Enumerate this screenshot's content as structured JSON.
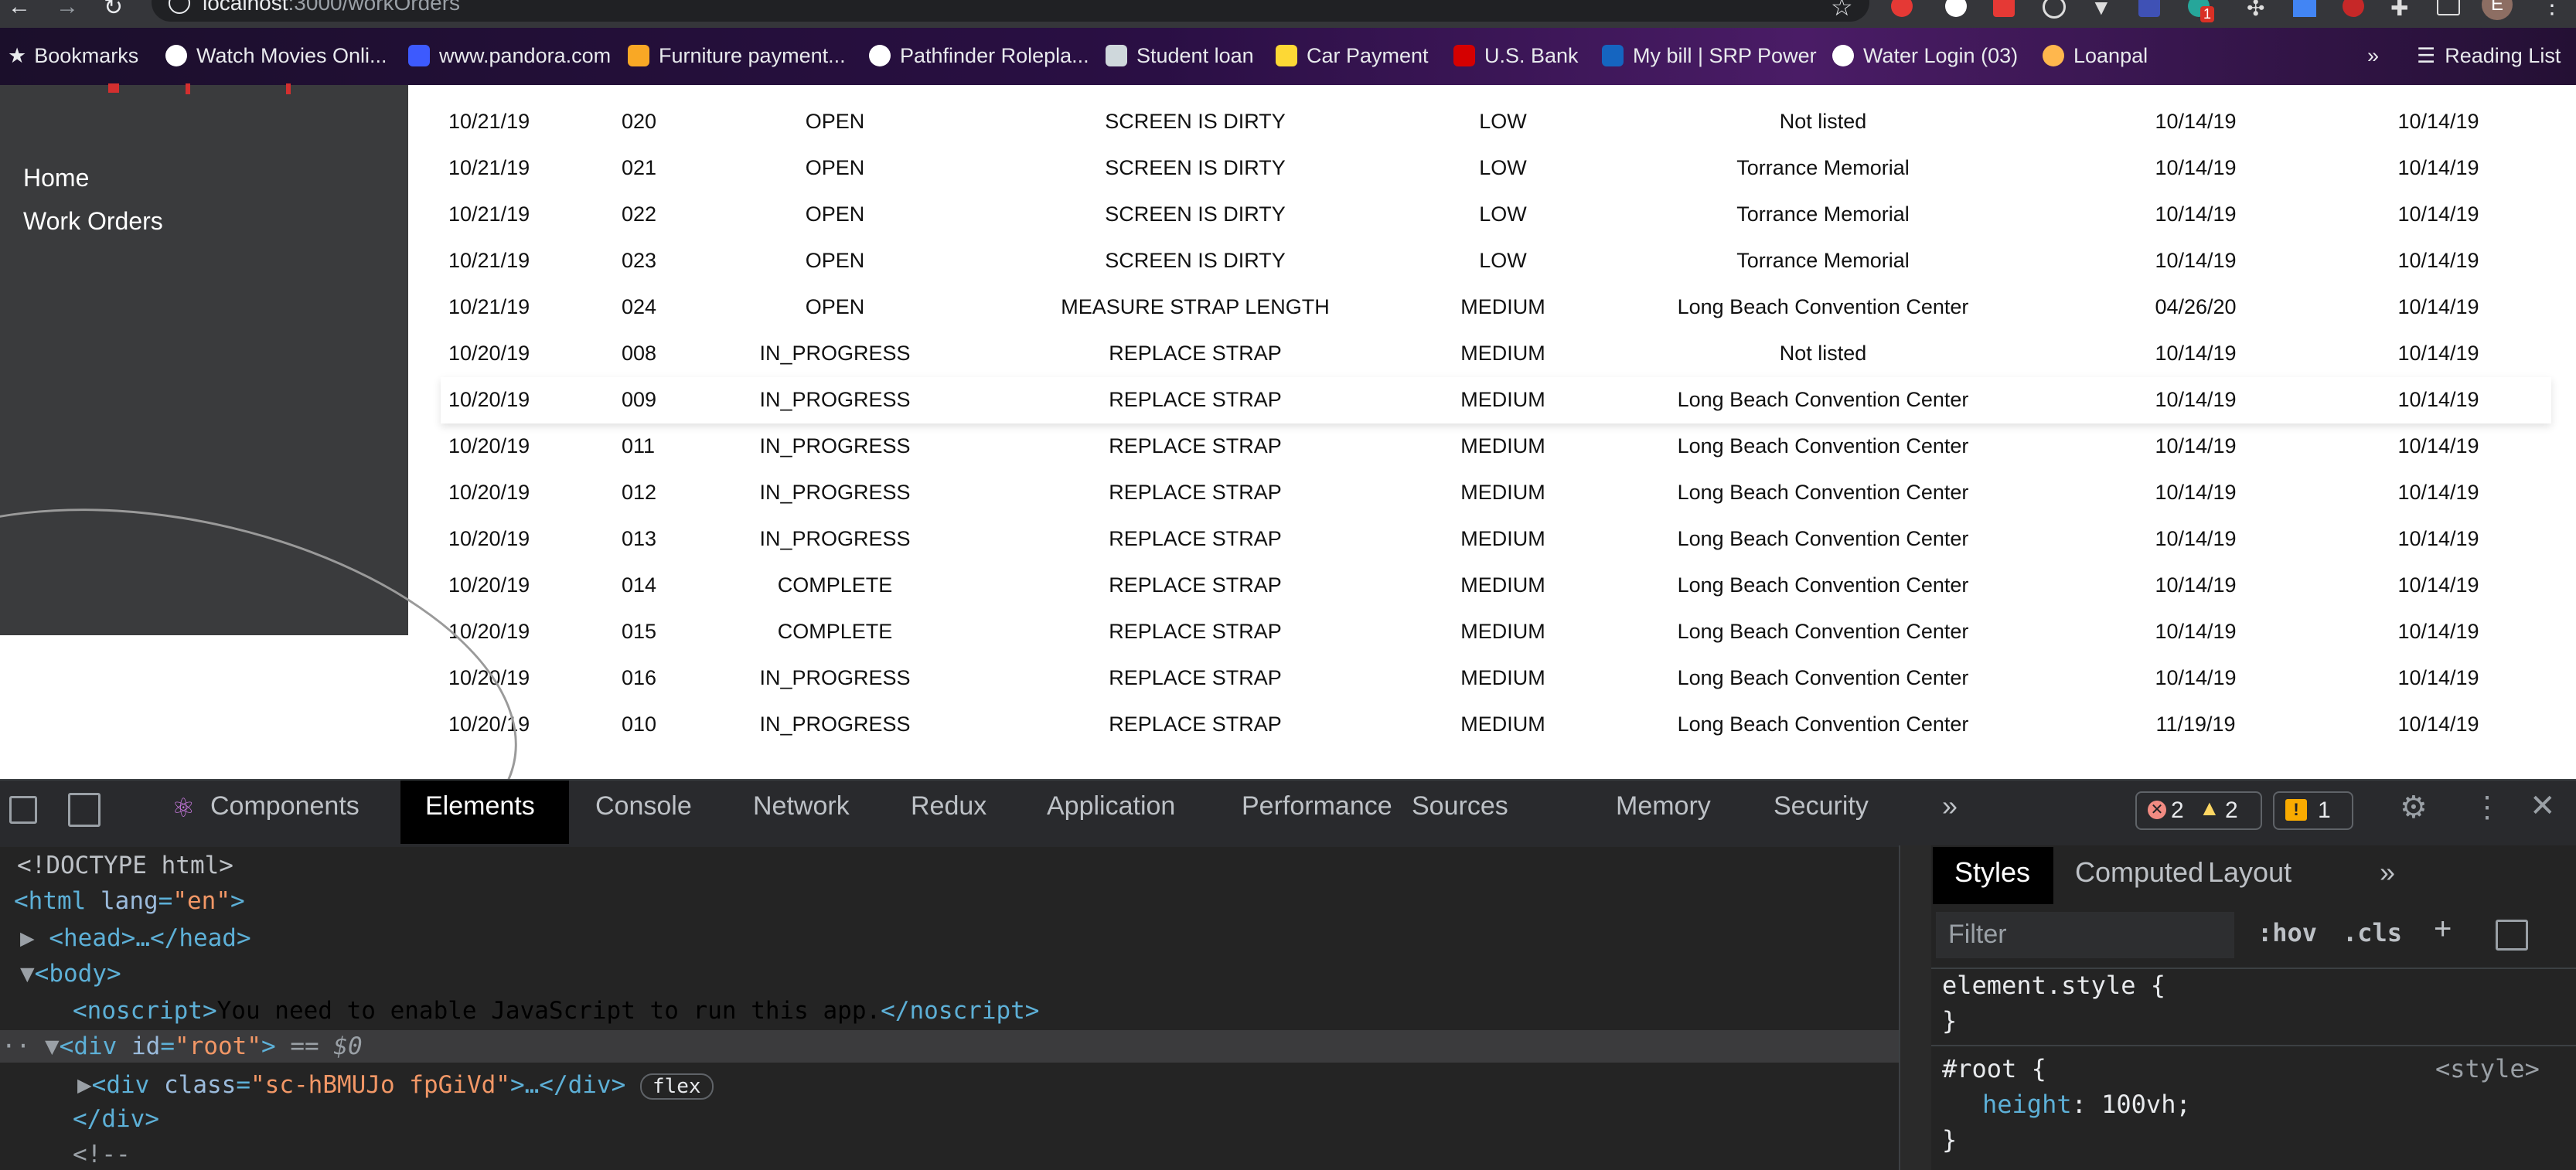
{
  "browser": {
    "url_host": "localhost",
    "url_path": ":3000/workOrders",
    "bookmarks": [
      "Bookmarks",
      "Watch Movies Onli...",
      "www.pandora.com",
      "Furniture payment...",
      "Pathfinder Rolepla...",
      "Student loan",
      "Car Payment",
      "U.S. Bank",
      "My bill | SRP Power",
      "Water Login (03)",
      "Loanpal"
    ],
    "overflow": "»",
    "reading_list": "Reading List",
    "avatar_letter": "E",
    "ext_badge": "1"
  },
  "sidebar": {
    "items": [
      "Home",
      "Work Orders"
    ]
  },
  "table": {
    "rows": [
      [
        "10/21/19",
        "020",
        "OPEN",
        "SCREEN IS DIRTY",
        "LOW",
        "Not listed",
        "10/14/19",
        "10/14/19"
      ],
      [
        "10/21/19",
        "021",
        "OPEN",
        "SCREEN IS DIRTY",
        "LOW",
        "Torrance Memorial",
        "10/14/19",
        "10/14/19"
      ],
      [
        "10/21/19",
        "022",
        "OPEN",
        "SCREEN IS DIRTY",
        "LOW",
        "Torrance Memorial",
        "10/14/19",
        "10/14/19"
      ],
      [
        "10/21/19",
        "023",
        "OPEN",
        "SCREEN IS DIRTY",
        "LOW",
        "Torrance Memorial",
        "10/14/19",
        "10/14/19"
      ],
      [
        "10/21/19",
        "024",
        "OPEN",
        "MEASURE STRAP LENGTH",
        "MEDIUM",
        "Long Beach Convention Center",
        "04/26/20",
        "10/14/19"
      ],
      [
        "10/20/19",
        "008",
        "IN_PROGRESS",
        "REPLACE STRAP",
        "MEDIUM",
        "Not listed",
        "10/14/19",
        "10/14/19"
      ],
      [
        "10/20/19",
        "009",
        "IN_PROGRESS",
        "REPLACE STRAP",
        "MEDIUM",
        "Long Beach Convention Center",
        "10/14/19",
        "10/14/19"
      ],
      [
        "10/20/19",
        "011",
        "IN_PROGRESS",
        "REPLACE STRAP",
        "MEDIUM",
        "Long Beach Convention Center",
        "10/14/19",
        "10/14/19"
      ],
      [
        "10/20/19",
        "012",
        "IN_PROGRESS",
        "REPLACE STRAP",
        "MEDIUM",
        "Long Beach Convention Center",
        "10/14/19",
        "10/14/19"
      ],
      [
        "10/20/19",
        "013",
        "IN_PROGRESS",
        "REPLACE STRAP",
        "MEDIUM",
        "Long Beach Convention Center",
        "10/14/19",
        "10/14/19"
      ],
      [
        "10/20/19",
        "014",
        "COMPLETE",
        "REPLACE STRAP",
        "MEDIUM",
        "Long Beach Convention Center",
        "10/14/19",
        "10/14/19"
      ],
      [
        "10/20/19",
        "015",
        "COMPLETE",
        "REPLACE STRAP",
        "MEDIUM",
        "Long Beach Convention Center",
        "10/14/19",
        "10/14/19"
      ],
      [
        "10/20/19",
        "016",
        "IN_PROGRESS",
        "REPLACE STRAP",
        "MEDIUM",
        "Long Beach Convention Center",
        "10/14/19",
        "10/14/19"
      ],
      [
        "10/20/19",
        "010",
        "IN_PROGRESS",
        "REPLACE STRAP",
        "MEDIUM",
        "Long Beach Convention Center",
        "11/19/19",
        "10/14/19"
      ]
    ],
    "highlighted_row": 6
  },
  "devtools": {
    "tabs": [
      "Components",
      "Elements",
      "Console",
      "Network",
      "Redux",
      "Application",
      "Performance",
      "Sources",
      "Memory",
      "Security"
    ],
    "active_tab": "Elements",
    "more": "»",
    "errors": "2",
    "warnings": "2",
    "issues": "1",
    "dom": {
      "doctype": "<!DOCTYPE html>",
      "html_open": "<html",
      "html_attr": "lang",
      "html_val": "\"en\"",
      "head": "<head>…</head>",
      "body": "<body>",
      "noscript_open": "<noscript>",
      "noscript_text": "You need to enable JavaScript to run this app.",
      "noscript_close": "</noscript>",
      "root_open": "<div",
      "root_attr": "id",
      "root_val": "\"root\"",
      "root_sel": "== $0",
      "child_open": "<div",
      "child_attr": "class",
      "child_val": "\"sc-hBMUJo fpGiVd\"",
      "child_rest": ">…</div>",
      "flex_badge": "flex",
      "div_close": "</div>",
      "comment": "<!--"
    },
    "styles": {
      "tabs": [
        "Styles",
        "Computed",
        "Layout"
      ],
      "more": "»",
      "filter_placeholder": "Filter",
      "hov": ":hov",
      "cls": ".cls",
      "rule1": "element.style {",
      "close": "}",
      "rule2": "#root {",
      "source": "<style>",
      "prop": "height",
      "value": "100vh;"
    }
  }
}
